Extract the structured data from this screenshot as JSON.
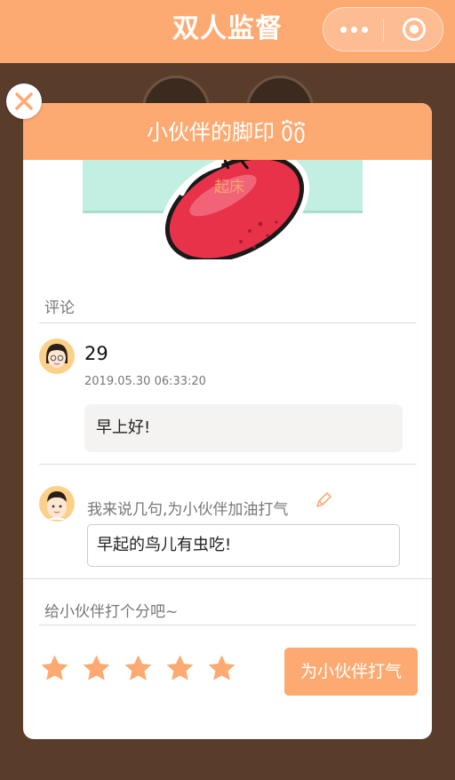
{
  "nav": {
    "title": "双人监督",
    "menu_icon": "more-dots-icon",
    "close_icon": "target-circle-icon"
  },
  "modal": {
    "title": "小伙伴的脚印",
    "title_icon": "footprints-icon",
    "task_label": "起床",
    "comment_section_label": "评论",
    "comment": {
      "nickname": "29",
      "time": "2019.05.30 06:33:20",
      "text": "早上好!"
    },
    "reply": {
      "prompt": "我来说几句,为小伙伴加油打气",
      "input_value": "早起的鸟儿有虫吃!"
    },
    "rating": {
      "label": "给小伙伴打个分吧~",
      "stars": 5,
      "max": 5
    },
    "cheer_button": "为小伙伴打气"
  },
  "colors": {
    "accent": "#fdaa72",
    "background": "#5a3c2b",
    "task_card": "#c2efe2"
  }
}
